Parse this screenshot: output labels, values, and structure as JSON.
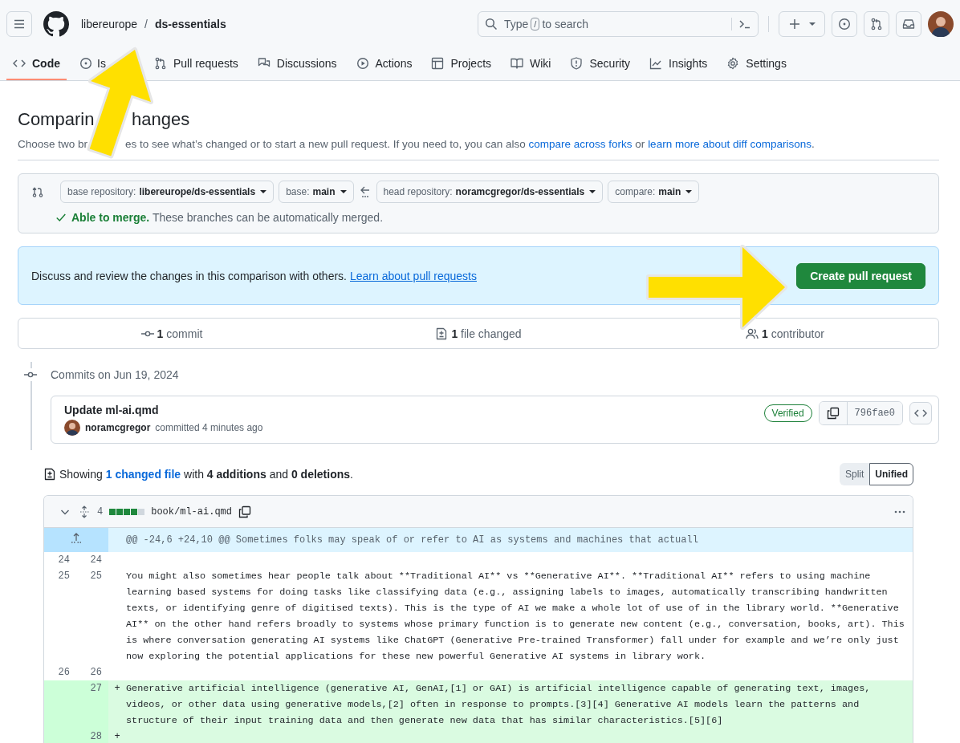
{
  "header": {
    "owner": "libereurope",
    "separator": "/",
    "repo": "ds-essentials",
    "search": {
      "before": "Type",
      "key": "/",
      "after": "to search"
    }
  },
  "tabs": [
    {
      "label": "Code",
      "kind": "code",
      "selected": true
    },
    {
      "label": "Is",
      "kind": "issue",
      "selected": false
    },
    {
      "label": "Pull requests",
      "kind": "pull",
      "selected": false
    },
    {
      "label": "Discussions",
      "kind": "discussion",
      "selected": false
    },
    {
      "label": "Actions",
      "kind": "play",
      "selected": false
    },
    {
      "label": "Projects",
      "kind": "table",
      "selected": false
    },
    {
      "label": "Wiki",
      "kind": "book",
      "selected": false
    },
    {
      "label": "Security",
      "kind": "shield",
      "selected": false
    },
    {
      "label": "Insights",
      "kind": "graph",
      "selected": false
    },
    {
      "label": "Settings",
      "kind": "gear",
      "selected": false
    }
  ],
  "compare": {
    "title_parts": [
      "Comparin",
      "hanges"
    ],
    "subtitle": [
      {
        "kind": "text",
        "text": "Choose two br"
      },
      {
        "kind": "text",
        "text": "es to see what’s changed or to start a new pull request. If you need to, you can also "
      },
      {
        "kind": "link",
        "text": "compare across forks"
      },
      {
        "kind": "text",
        "text": " or "
      },
      {
        "kind": "link",
        "text": "learn more about diff comparisons"
      },
      {
        "kind": "text",
        "text": "."
      }
    ],
    "selects": [
      {
        "label": "base repository:",
        "value": "libereurope/ds-essentials"
      },
      {
        "label": "base:",
        "value": "main"
      },
      {
        "label": "head repository:",
        "value": "noramcgregor/ds-essentials"
      },
      {
        "label": "compare:",
        "value": "main"
      }
    ],
    "merge": {
      "status": "Able to merge.",
      "message": "These branches can be automatically merged."
    },
    "banner": {
      "text": "Discuss and review the changes in this comparison with others.",
      "link": "Learn about pull requests",
      "button": "Create pull request"
    },
    "stats": [
      {
        "kind": "commit",
        "count": "1",
        "label": "commit"
      },
      {
        "kind": "file",
        "count": "1",
        "label": "file changed"
      },
      {
        "kind": "people",
        "count": "1",
        "label": "contributor"
      }
    ]
  },
  "commits": {
    "heading": "Commits on Jun 19, 2024",
    "items": [
      {
        "title": "Update ml-ai.qmd",
        "author": "noramcgregor",
        "meta": "committed 4 minutes ago",
        "badge": "Verified",
        "sha": "796fae0"
      }
    ]
  },
  "diff": {
    "summary": {
      "prefix": "Showing",
      "link": "1 changed file",
      "rest": "with **4 additions** and **0 deletions**."
    },
    "views": [
      {
        "label": "Split",
        "selected": false
      },
      {
        "label": "Unified",
        "selected": true
      }
    ],
    "file": {
      "count": "4",
      "blocks": [
        {
          "added": true
        },
        {
          "added": true
        },
        {
          "added": true
        },
        {
          "added": true
        },
        {
          "added": false
        }
      ],
      "path": "book/ml-ai.qmd",
      "hunk": "@@ -24,6 +24,10 @@ Sometimes folks may speak of or refer to AI as systems and machines that actuall",
      "lines": [
        {
          "kind": "context",
          "old": "24",
          "new": "24"
        },
        {
          "kind": "context",
          "old": "25",
          "new": "25",
          "text": "You might also sometimes hear people talk about **Traditional AI** vs **Generative AI**. **Traditional AI** refers to using machine learning based systems for doing tasks like classifying data (e.g., assigning labels to images, automatically transcribing handwritten texts, or identifying genre of digitised texts). This is the type of AI we make a whole lot of use of in the library world. **Generative AI** on the other hand refers broadly to systems whose primary function is to generate new content (e.g., conversation, books, art). This is where conversation generating AI systems like ChatGPT (Generative Pre-trained Transformer) fall under for example and we’re only just now exploring the potential applications for these new powerful Generative AI systems in library work."
        },
        {
          "kind": "context",
          "old": "26",
          "new": "26"
        },
        {
          "kind": "added",
          "new": "27",
          "marker": "+",
          "text": "Generative artificial intelligence (generative AI, GenAI,[1] or GAI) is artificial intelligence capable of generating text, images, videos, or other data using generative models,[2] often in response to prompts.[3][4] Generative AI models learn the patterns and structure of their input training data and then generate new data that has similar characteristics.[5][6]"
        },
        {
          "kind": "added",
          "new": "28",
          "marker": "+"
        }
      ]
    }
  }
}
